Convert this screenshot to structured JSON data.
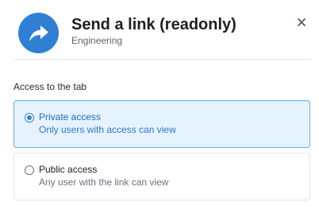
{
  "dialog": {
    "title": "Send a link (readonly)",
    "subtitle": "Engineering",
    "header_icon": "share-arrow-icon",
    "close_icon": "close-icon",
    "accent_color": "#2f80d4"
  },
  "access": {
    "section_label": "Access to the tab",
    "selected": "private",
    "options": [
      {
        "id": "private",
        "title": "Private access",
        "description": "Only users with access can view",
        "checked": true
      },
      {
        "id": "public",
        "title": "Public access",
        "description": "Any user with the link can view",
        "checked": false
      }
    ]
  }
}
